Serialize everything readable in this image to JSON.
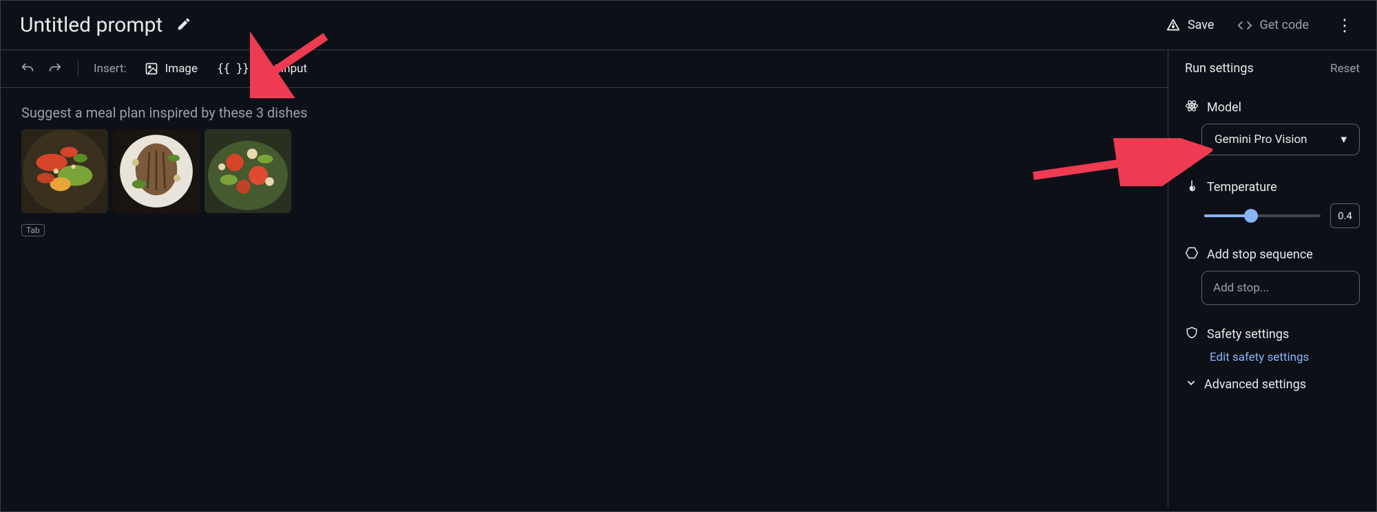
{
  "header": {
    "title": "Untitled prompt",
    "save_label": "Save",
    "getcode_label": "Get code"
  },
  "toolbar": {
    "insert_label": "Insert:",
    "image_label": "Image",
    "testinput_label": "Test input",
    "testinput_glyph": "{{ }}"
  },
  "prompt": {
    "text": "Suggest a meal plan inspired by these 3 dishes",
    "tab_pill": "Tab"
  },
  "sidebar": {
    "title": "Run settings",
    "reset_label": "Reset",
    "model_label": "Model",
    "model_value": "Gemini Pro Vision",
    "temperature_label": "Temperature",
    "temperature_value": "0.4",
    "stop_label": "Add stop sequence",
    "stop_placeholder": "Add stop...",
    "safety_label": "Safety settings",
    "safety_link": "Edit safety settings",
    "advanced_label": "Advanced settings"
  }
}
